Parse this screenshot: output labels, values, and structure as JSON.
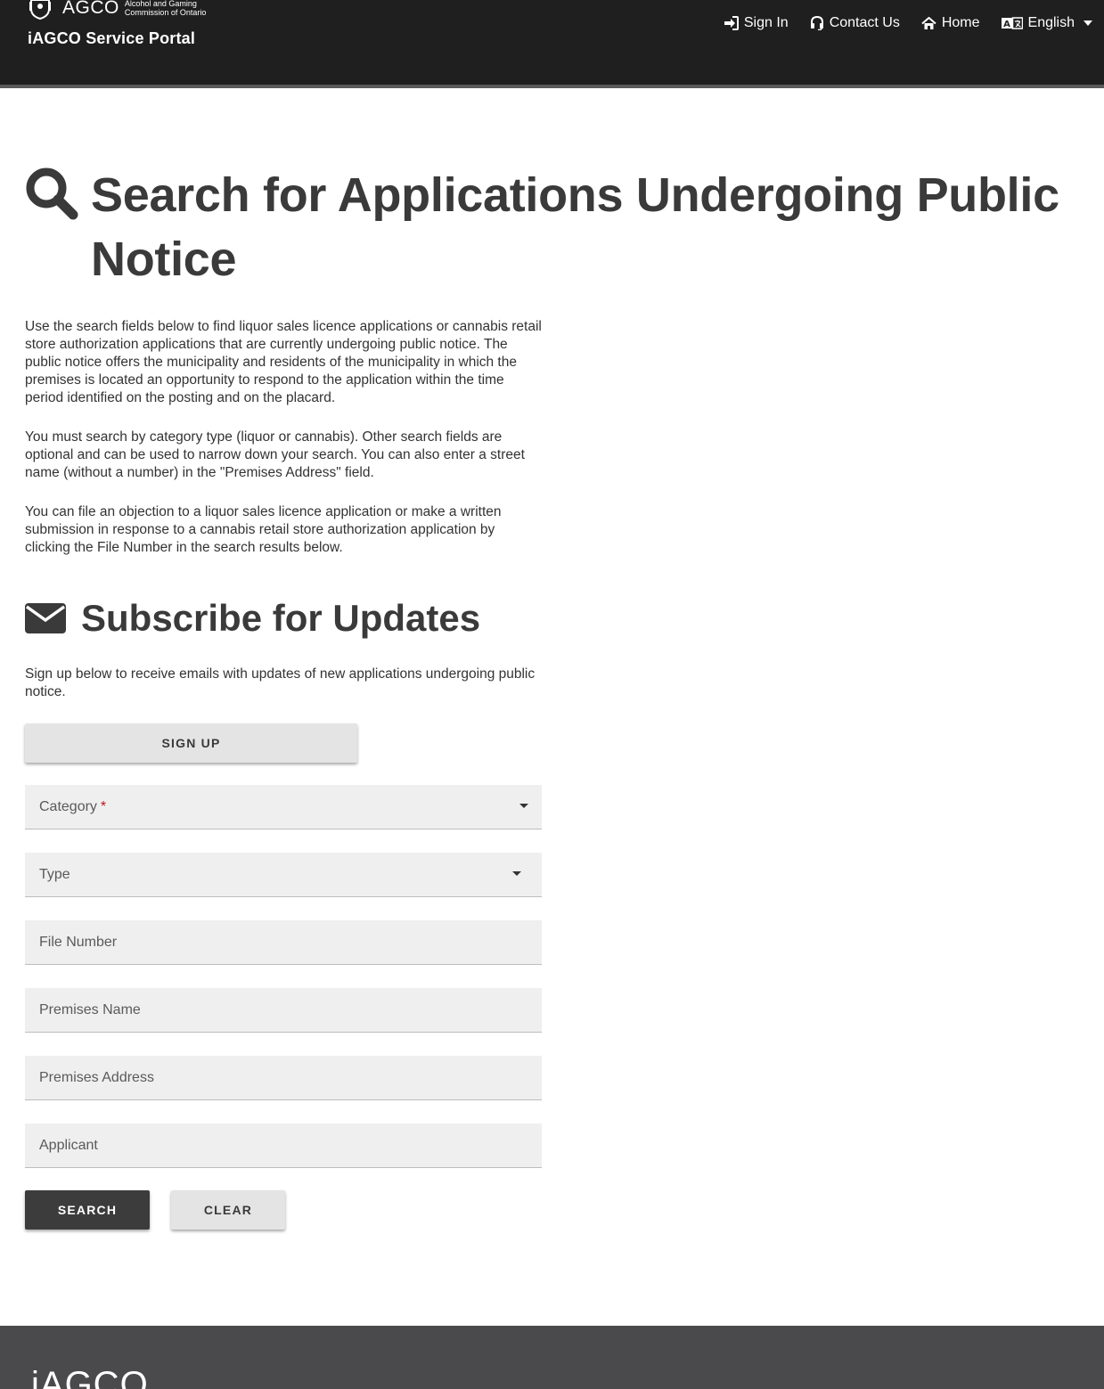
{
  "header": {
    "agco_word": "AGCO",
    "agco_sub_line1": "Alcohol and Gaming",
    "agco_sub_line2": "Commission of Ontario",
    "portal_title": "iAGCO Service Portal",
    "nav": {
      "sign_in": "Sign In",
      "contact_us": "Contact Us",
      "home": "Home",
      "language": "English"
    }
  },
  "main": {
    "title": "Search for Applications Undergoing Public Notice",
    "paragraph1": "Use the search fields below to find liquor sales licence applications or cannabis retail store authorization applications that are currently undergoing public notice. The public notice offers the municipality and residents of the municipality in which the premises is located an opportunity to respond to the application within the time period identified on the posting and on the placard.",
    "paragraph2": "You must search by category type (liquor or cannabis). Other search fields are optional and can be used to narrow down your search. You can also enter a street name (without a number) in the \"Premises Address\" field.",
    "paragraph3": "You can file an objection to a liquor sales licence application or make a written submission in response to a cannabis retail store authorization application by clicking the File Number in the search results below.",
    "subscribe_title": "Subscribe for Updates",
    "subscribe_text": "Sign up below to receive emails with updates of new applications undergoing public notice.",
    "signup_label": "SIGN UP"
  },
  "form": {
    "category_label": "Category",
    "category_required_mark": "*",
    "type_label": "Type",
    "file_number_label": "File Number",
    "premises_name_label": "Premises Name",
    "premises_address_label": "Premises Address",
    "applicant_label": "Applicant",
    "search_label": "SEARCH",
    "clear_label": "CLEAR"
  },
  "footer": {
    "logo_text": "iAGCO"
  },
  "colors": {
    "header_bg": "#1f1f1f",
    "footer_bg": "#4a4a4c",
    "heading": "#3a3a3a",
    "required": "#c0141a",
    "primary_button": "#3c3c3c"
  }
}
